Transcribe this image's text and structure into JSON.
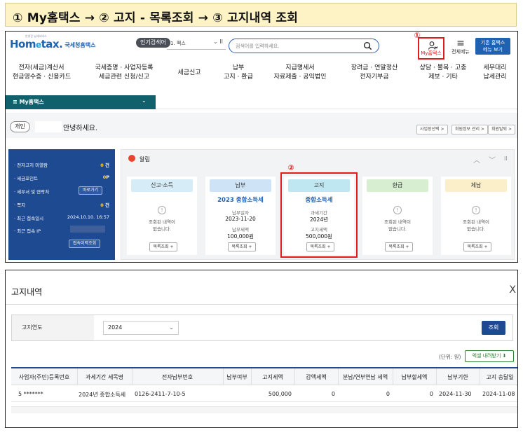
{
  "banner": {
    "text": "① My홈택스 → ② 고지 - 목록조회 → ③ 고지내역  조회"
  },
  "header": {
    "logo_tiny": "안녕은 납세서비스",
    "logo_main_prefix": "Hom",
    "logo_main_e": "e",
    "logo_main_suffix": "tax.",
    "logo_sub": "국세청홈택스",
    "popular_badge": "인기검색어",
    "popular_item": "1. 팩스",
    "popular_pause": "II",
    "search_placeholder": "검색어를 입력하세요.",
    "callout_1": "①",
    "myhome_label": "My홈택스",
    "menu_label": "전체메뉴",
    "old_btn_line1": "기존 홈택스",
    "old_btn_line2": "메뉴 보기"
  },
  "nav": [
    {
      "l1": "전자(세금)계산서",
      "l2": "현금영수증 · 신용카드"
    },
    {
      "l1": "국세증명 · 사업자등록",
      "l2": "세금관련 신청/신고"
    },
    {
      "l1": "세금신고",
      "l2": ""
    },
    {
      "l1": "납부",
      "l2": "고지 · 환급"
    },
    {
      "l1": "지급명세서",
      "l2": "자료제출 · 공익법인"
    },
    {
      "l1": "장려금 · 연말정산",
      "l2": "전자기부금"
    },
    {
      "l1": "상담 · 불복 · 고충",
      "l2": "제보 · 기타"
    },
    {
      "l1": "세무대리",
      "l2": "납세관리"
    }
  ],
  "subbar": {
    "label": "≡  My홈택스"
  },
  "greeting": {
    "tag": "개인",
    "text": "안녕하세요.",
    "links": [
      "사업장선택 >",
      "회원정보 관리 >",
      "회원탈퇴 >"
    ]
  },
  "info": {
    "rows": [
      {
        "label": "· 전자고지 미열람",
        "num": "0",
        "unit": "건"
      },
      {
        "label": "· 세금포인트",
        "num": "0",
        "unit": "P"
      },
      {
        "label": "· 세무서 및 연락처",
        "num": "",
        "unit": ""
      },
      {
        "label": "· 쪽지",
        "num": "0",
        "unit": "건"
      },
      {
        "label": "· 최근 접속일시",
        "num": "",
        "unit": "2024.10.10.  16:57"
      },
      {
        "label": "· 최근 접속 IP",
        "num": "",
        "unit": ""
      }
    ],
    "shortcut_btn": "바로가기",
    "history_btn": "접속이력조회"
  },
  "alerts": {
    "title": "알림",
    "callout_2": "②",
    "ctrl_up": "︿",
    "ctrl_down": "﹀",
    "ctrl_pause": "II",
    "cards": [
      {
        "head": "신고·소득",
        "head_color": "#d6ecf7",
        "title": "",
        "empty1": "조회된 내역이",
        "empty2": "없습니다.",
        "lbl1": "",
        "val1": "",
        "lbl2": "",
        "val2": "",
        "btn": "목록조회 +"
      },
      {
        "head": "납부",
        "head_color": "#cfe3f7",
        "title": "2023 종합소득세",
        "empty1": "",
        "empty2": "",
        "lbl1": "납부일자",
        "val1": "2023-11-20",
        "lbl2": "납부세액",
        "val2": "100,000원",
        "btn": "목록조회 +"
      },
      {
        "head": "고지",
        "head_color": "#bfe7f2",
        "title": "종합소득세",
        "empty1": "",
        "empty2": "",
        "lbl1": "과세기간",
        "val1": "2024년",
        "lbl2": "고지세액",
        "val2": "500,000원",
        "btn": "목록조회 +"
      },
      {
        "head": "환급",
        "head_color": "#d7efd0",
        "title": "",
        "empty1": "조회된 내역이",
        "empty2": "없습니다.",
        "lbl1": "",
        "val1": "",
        "lbl2": "",
        "val2": "",
        "btn": "목록조회 +"
      },
      {
        "head": "체납",
        "head_color": "#fbefc9",
        "title": "",
        "empty1": "조회된 내역이",
        "empty2": "없습니다.",
        "lbl1": "",
        "val1": "",
        "lbl2": "",
        "val2": "",
        "btn": "목록조회 +"
      }
    ]
  },
  "notice_detail": {
    "title": "고지내역",
    "close": "X",
    "filter_label": "고지연도",
    "filter_value": "2024",
    "filter_caret": "⌄",
    "query_btn": "조회",
    "unit": "(단위: 원)",
    "excel_btn": "엑셀 내려받기 ⬇",
    "columns": [
      "사업자(주민)등록번호",
      "과세기간 세목명",
      "전자납부번호",
      "납부여부",
      "고지세액",
      "감액세액",
      "분납/연부연납 세액",
      "납부할세액",
      "납부기한",
      "고지 송달일"
    ],
    "row": [
      "5        *******",
      "2024년 종합소득세",
      "0126-2411-7-10-5",
      "",
      "500,000",
      "0",
      "0",
      "0",
      "2024-11-30",
      "2024-11-08"
    ]
  },
  "colors": {
    "accent": "#1e4a92",
    "highlight": "#e21b1b",
    "subbar": "#10616c"
  }
}
